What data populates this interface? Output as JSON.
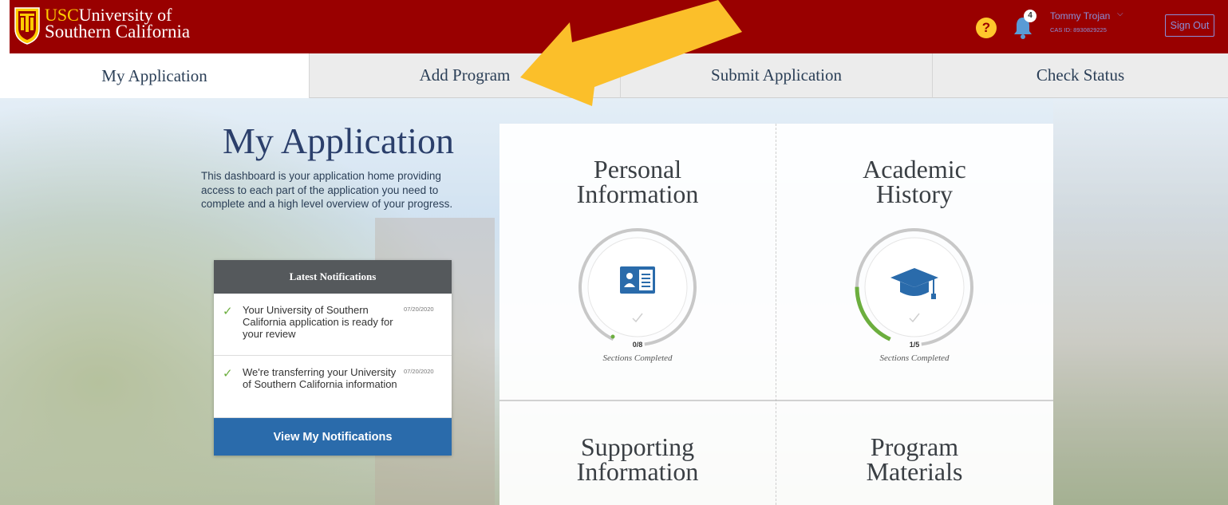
{
  "header": {
    "logo_usc": "USC",
    "logo_line1": "University of",
    "logo_line2": "Southern California",
    "help_label": "?",
    "notification_count": "4",
    "user_name": "Tommy Trojan",
    "user_id": "CAS ID: 8930829225",
    "signout_label": "Sign Out",
    "icons": [
      "usc-seal-icon",
      "help-icon",
      "bell-icon",
      "chevron-down-icon"
    ]
  },
  "tabs": [
    {
      "label": "My Application",
      "active": true
    },
    {
      "label": "Add Program",
      "active": false
    },
    {
      "label": "Submit Application",
      "active": false
    },
    {
      "label": "Check Status",
      "active": false
    }
  ],
  "main": {
    "title": "My Application",
    "intro": "This dashboard is your application home providing access to each part of the application you need to complete and a high level overview of your progress."
  },
  "notifications": {
    "heading": "Latest Notifications",
    "items": [
      {
        "message": "Your University of Southern California application is ready for your review",
        "date": "07/20/2020"
      },
      {
        "message": "We're transferring your University of Southern California information",
        "date": "07/20/2020"
      }
    ],
    "button_label": "View My Notifications"
  },
  "sections": [
    {
      "title_l1": "Personal",
      "title_l2": "Information",
      "count": "0/8",
      "label": "Sections Completed",
      "completed": 0,
      "total": 8,
      "icon": "id-card-icon"
    },
    {
      "title_l1": "Academic",
      "title_l2": "History",
      "count": "1/5",
      "label": "Sections Completed",
      "completed": 1,
      "total": 5,
      "icon": "graduation-cap-icon"
    },
    {
      "title_l1": "Supporting",
      "title_l2": "Information"
    },
    {
      "title_l1": "Program",
      "title_l2": "Materials"
    }
  ],
  "colors": {
    "brand_red": "#990000",
    "brand_gold": "#ffc72c",
    "progress_green": "#6cae3e",
    "button_blue": "#2a6bab"
  }
}
